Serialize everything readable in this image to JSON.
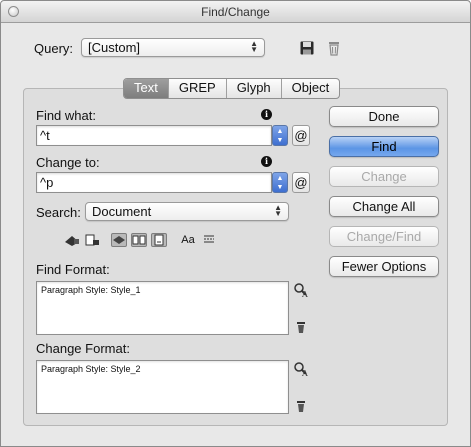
{
  "window": {
    "title": "Find/Change"
  },
  "query": {
    "label": "Query:",
    "value": "[Custom]"
  },
  "tabs": [
    {
      "label": "Text",
      "active": true
    },
    {
      "label": "GREP",
      "active": false
    },
    {
      "label": "Glyph",
      "active": false
    },
    {
      "label": "Object",
      "active": false
    }
  ],
  "find": {
    "label": "Find what:",
    "value": "^t",
    "special_char_symbol": "@"
  },
  "change": {
    "label": "Change to:",
    "value": "^p",
    "special_char_symbol": "@"
  },
  "search": {
    "label": "Search:",
    "value": "Document"
  },
  "options_toolbar": {
    "case_sensitive_label": "Aa"
  },
  "find_format": {
    "label": "Find Format:",
    "text": "Paragraph Style: Style_1"
  },
  "change_format": {
    "label": "Change Format:",
    "text": "Paragraph Style: Style_2"
  },
  "buttons": {
    "done": "Done",
    "find": "Find",
    "change": "Change",
    "change_all": "Change All",
    "change_find": "Change/Find",
    "fewer_options": "Fewer Options"
  },
  "info_symbol": "i",
  "colors": {
    "primary_button": "#5c95e5",
    "active_tab": "#8a8a8a",
    "window_bg": "#e8e8e8"
  }
}
